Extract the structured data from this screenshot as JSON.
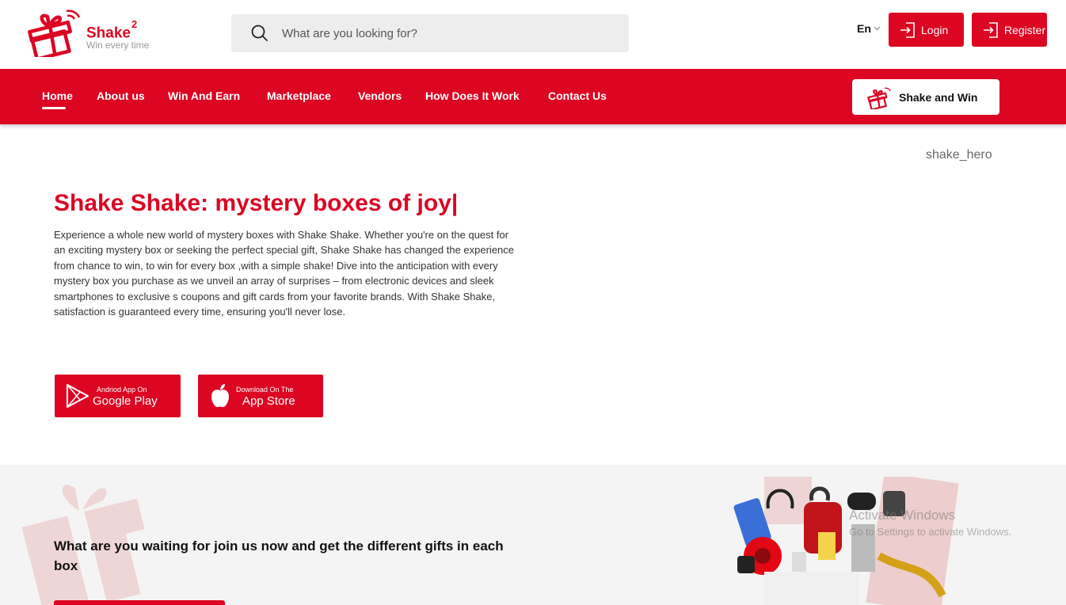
{
  "brand": {
    "name": "Shake",
    "superscript": "2",
    "tagline": "Win every time"
  },
  "search": {
    "placeholder": "What are you looking for?"
  },
  "header": {
    "language": "En",
    "login_label": "Login",
    "register_label": "Register"
  },
  "nav": {
    "items": [
      "Home",
      "About us",
      "Win And Earn",
      "Marketplace",
      "Vendors",
      "How Does It Work",
      "Contact Us"
    ],
    "active": "Home",
    "shake_win_label": "Shake and Win"
  },
  "hero": {
    "image_alt": "shake_hero",
    "title": "Shake Shake: mystery boxes of joy|",
    "text": "Experience a whole new world of mystery boxes with Shake Shake. Whether you're on the quest for an exciting mystery box or seeking the perfect special gift, Shake Shake has changed the experience from chance to win, to win for every box ,with a simple shake! Dive into the anticipation with every mystery box you purchase as we unveil an array of surprises – from electronic devices and sleek smartphones to exclusive s coupons and gift cards from your favorite brands. With Shake Shake, satisfaction is guaranteed every time, ensuring you'll never lose.",
    "google_play": {
      "small": "Andriod App On",
      "big": "Google Play"
    },
    "app_store": {
      "small": "Download On The",
      "big": "App Store"
    }
  },
  "cta": {
    "text": "What are you waiting for join us now and get the different gifts in each box"
  },
  "watermark": {
    "line1": "Activate Windows",
    "line2": "Go to Settings to activate Windows."
  },
  "colors": {
    "primary": "#dc0522",
    "lower_bg": "#f4f4f4"
  }
}
